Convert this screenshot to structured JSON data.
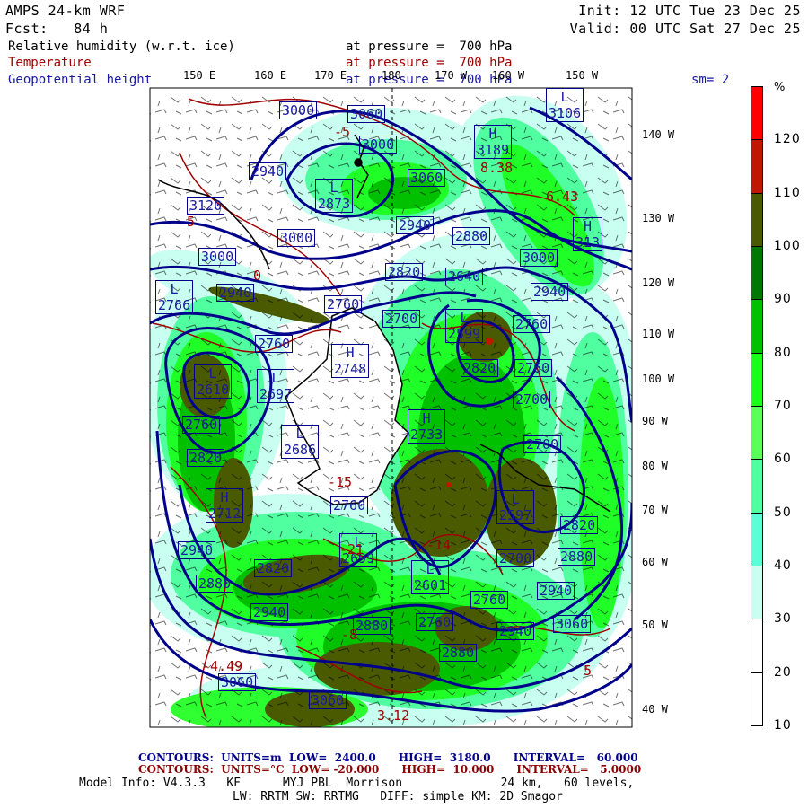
{
  "header": {
    "model": "AMPS 24-km WRF",
    "forecast": "Fcst:   84 h",
    "init": "Init: 12 UTC Tue 23 Dec 25",
    "valid": "Valid: 00 UTC Sat 27 Dec 25"
  },
  "fields": [
    {
      "name": "Relative humidity (w.r.t. ice)",
      "level": "at pressure =  700 hPa",
      "color": "#000000"
    },
    {
      "name": "Temperature",
      "level": "at pressure =  700 hPa",
      "color": "#a00000"
    },
    {
      "name": "Geopotential height",
      "level": "at pressure =  700 hPa",
      "color": "#1a1aa0"
    }
  ],
  "smoothing": "sm= 2",
  "lon_labels": [
    "150 E",
    "160 E",
    "170 E",
    "180",
    "170 W",
    "160 W",
    "150 W"
  ],
  "lat_labels": [
    "140 W",
    "130 W",
    "120 W",
    "110 W",
    "100 W",
    "90 W",
    "80 W",
    "70 W",
    "60 W",
    "50 W",
    "40 W"
  ],
  "colorbar": {
    "unit": "%",
    "labels": [
      "120",
      "110",
      "100",
      "90",
      "80",
      "70",
      "60",
      "50",
      "40",
      "30",
      "20",
      "10"
    ],
    "colors": [
      "#ff0000",
      "#c01800",
      "#4a5a00",
      "#007800",
      "#00c000",
      "#1aff1a",
      "#5aff5a",
      "#50ffa0",
      "#5affd8",
      "#c8fff0",
      "#ffffff",
      "#ffffff",
      "#ffffff"
    ]
  },
  "contour_labels": [
    {
      "v": "3000"
    },
    {
      "v": "3060"
    },
    {
      "v": "3000"
    },
    {
      "v": "2940"
    },
    {
      "c": "L",
      "v": "2873"
    },
    {
      "v": "3060"
    },
    {
      "v": "3120"
    },
    {
      "v": "2940"
    },
    {
      "v": "2880"
    },
    {
      "v": "3000"
    },
    {
      "v": "3000"
    },
    {
      "c": "H",
      "v": "3189"
    },
    {
      "c": "L",
      "v": "3106"
    },
    {
      "c": "H",
      "v": "313"
    },
    {
      "v": "3000"
    },
    {
      "c": "L",
      "v": "2766"
    },
    {
      "v": "2940"
    },
    {
      "v": "2820"
    },
    {
      "v": "2640"
    },
    {
      "v": "2940"
    },
    {
      "v": "2760"
    },
    {
      "v": "2700"
    },
    {
      "c": "L",
      "v": "2599"
    },
    {
      "v": "2760"
    },
    {
      "v": "2760"
    },
    {
      "c": "H",
      "v": "2748"
    },
    {
      "v": "2820"
    },
    {
      "v": "2760"
    },
    {
      "c": "L",
      "v": "2610"
    },
    {
      "c": "L",
      "v": "2697"
    },
    {
      "v": "2700"
    },
    {
      "v": "2760"
    },
    {
      "c": "L",
      "v": "2686"
    },
    {
      "c": "H",
      "v": "2733"
    },
    {
      "v": "2700"
    },
    {
      "v": "2820"
    },
    {
      "c": "H",
      "v": "2712"
    },
    {
      "v": "2760"
    },
    {
      "c": "L",
      "v": "2597"
    },
    {
      "v": "2820"
    },
    {
      "c": "L",
      "v": "2699"
    },
    {
      "v": "2940"
    },
    {
      "v": "2820"
    },
    {
      "v": "2880"
    },
    {
      "v": "2700"
    },
    {
      "v": "2880"
    },
    {
      "c": "L",
      "v": "2601"
    },
    {
      "v": "2760"
    },
    {
      "v": "2940"
    },
    {
      "v": "2940"
    },
    {
      "v": "2880"
    },
    {
      "v": "2760"
    },
    {
      "v": "2940"
    },
    {
      "v": "3060"
    },
    {
      "v": "2880"
    },
    {
      "v": "3060"
    },
    {
      "v": "3060"
    }
  ],
  "temperature_labels": [
    "-5",
    "5",
    "0",
    "8.38",
    "6.43",
    "-15",
    "-21",
    "-14",
    "-8",
    "-4.49",
    "5",
    "3.12"
  ],
  "footer": {
    "height_contours": "CONTOURS:  UNITS=m  LOW=  2400.0      HIGH=  3180.0      INTERVAL=   60.000",
    "temp_contours": "CONTOURS:  UNITS=°C  LOW= -20.000      HIGH=  10.000      INTERVAL=   5.0000",
    "model_info_1": "Model Info: V4.3.3   KF      MYJ PBL  Morrison              24 km,   60 levels,",
    "model_info_2": "LW: RRTM SW: RRTMG   DIFF: simple KM: 2D Smagor"
  }
}
